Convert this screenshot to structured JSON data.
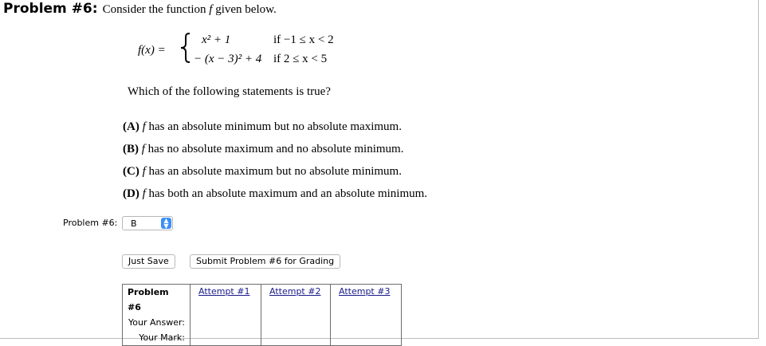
{
  "problem": {
    "heading_number": "Problem #6:",
    "intro_text": "Consider the function",
    "intro_var": "f",
    "intro_tail": "given below.",
    "function_lhs": "f(x) =",
    "cases": [
      {
        "expr": "x² + 1",
        "cond": "if  −1 ≤ x < 2"
      },
      {
        "expr": "− (x − 3)² + 4",
        "cond": "if   2 ≤ x < 5"
      }
    ],
    "question": "Which of the following statements is true?",
    "choices": [
      {
        "letter": "(A)",
        "var": "f",
        "text": "has an absolute minimum but no absolute maximum."
      },
      {
        "letter": "(B)",
        "var": "f",
        "text": "has no absolute maximum and no absolute minimum."
      },
      {
        "letter": "(C)",
        "var": "f",
        "text": "has an absolute maximum but no absolute minimum."
      },
      {
        "letter": "(D)",
        "var": "f",
        "text": "has both an absolute maximum and an absolute minimum."
      }
    ]
  },
  "answer": {
    "label": "Problem #6:",
    "selected": "B",
    "icon": "updown-chevron-icon"
  },
  "buttons": {
    "save_label": "Just Save",
    "submit_label": "Submit Problem #6 for Grading"
  },
  "attempts_table": {
    "header": "Problem #6",
    "attempts": [
      "Attempt #1",
      "Attempt #2",
      "Attempt #3"
    ],
    "row_labels": [
      "Your Answer:",
      "Your Mark:"
    ]
  },
  "colors": {
    "accent": "#3b8ff7",
    "link": "#1a1a8a",
    "border": "#6d6d6d"
  }
}
